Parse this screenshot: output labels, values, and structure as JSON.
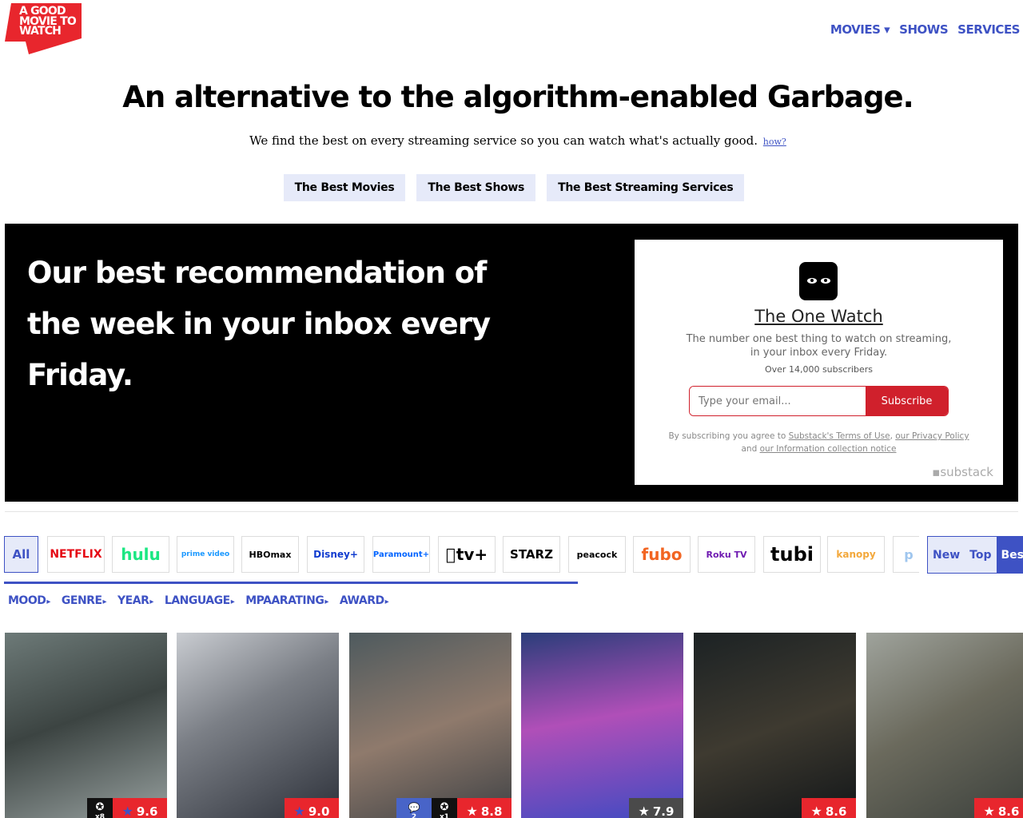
{
  "logo": {
    "text": "A GOOD MOVIE TO WATCH"
  },
  "nav": [
    {
      "label": "MOVIES ▾"
    },
    {
      "label": "SHOWS"
    },
    {
      "label": "SERVICES"
    }
  ],
  "hero": {
    "headline": "An alternative to the algorithm-enabled Garbage.",
    "tagline": "We find the best on every streaming service so you can watch what's actually good.",
    "how_link": "how?",
    "ctas": [
      "The Best Movies",
      "The Best Shows",
      "The Best Streaming Services"
    ]
  },
  "newsletter": {
    "heading": "Our best recommendation of the week in your inbox every Friday.",
    "card": {
      "title": "The One Watch",
      "description": "The number one best thing to watch on streaming, in your inbox every Friday.",
      "subscribers": "Over 14,000 subscribers",
      "email_placeholder": "Type your email...",
      "subscribe_label": "Subscribe",
      "legal_prefix": "By subscribing you agree to ",
      "legal_terms": "Substack's Terms of Use",
      "legal_comma": ", ",
      "legal_privacy": "our Privacy Policy",
      "legal_and": " and ",
      "legal_info": "our Information collection notice",
      "brand": "substack"
    }
  },
  "services": [
    {
      "label": "All",
      "color": "#3e52c4"
    },
    {
      "label": "NETFLIX",
      "color": "#e50914"
    },
    {
      "label": "hulu",
      "color": "#1ce783"
    },
    {
      "label": "prime video",
      "color": "#1a98ff"
    },
    {
      "label": "HBOmax",
      "color": "#000000"
    },
    {
      "label": "Disney+",
      "color": "#113ccf"
    },
    {
      "label": "Paramount+",
      "color": "#0064ff"
    },
    {
      "label": "tv+",
      "color": "#000000"
    },
    {
      "label": "STARZ",
      "color": "#000000"
    },
    {
      "label": "peacock",
      "color": "#000000"
    },
    {
      "label": "fubo",
      "color": "#f26522"
    },
    {
      "label": "Roku TV",
      "color": "#6f1ab1"
    },
    {
      "label": "tubi",
      "color": "#000000"
    },
    {
      "label": "kanopy",
      "color": "#f3a83b"
    },
    {
      "label": "p",
      "color": "#9fc6ee"
    }
  ],
  "sort": [
    "New",
    "Top",
    "Best"
  ],
  "filters": [
    "MOOD",
    "GENRE",
    "YEAR",
    "LANGUAGE",
    "MPAARATING",
    "AWARD"
  ],
  "cards": [
    {
      "score": "9.6",
      "star": "blue",
      "award": "x8"
    },
    {
      "score": "9.0",
      "star": "blue"
    },
    {
      "score": "8.8",
      "star": "white",
      "award": "x1",
      "comments": "2"
    },
    {
      "score": "7.9",
      "star": "white",
      "grey": true
    },
    {
      "score": "8.6",
      "star": "white"
    },
    {
      "score": "8.6",
      "star": "white"
    }
  ]
}
